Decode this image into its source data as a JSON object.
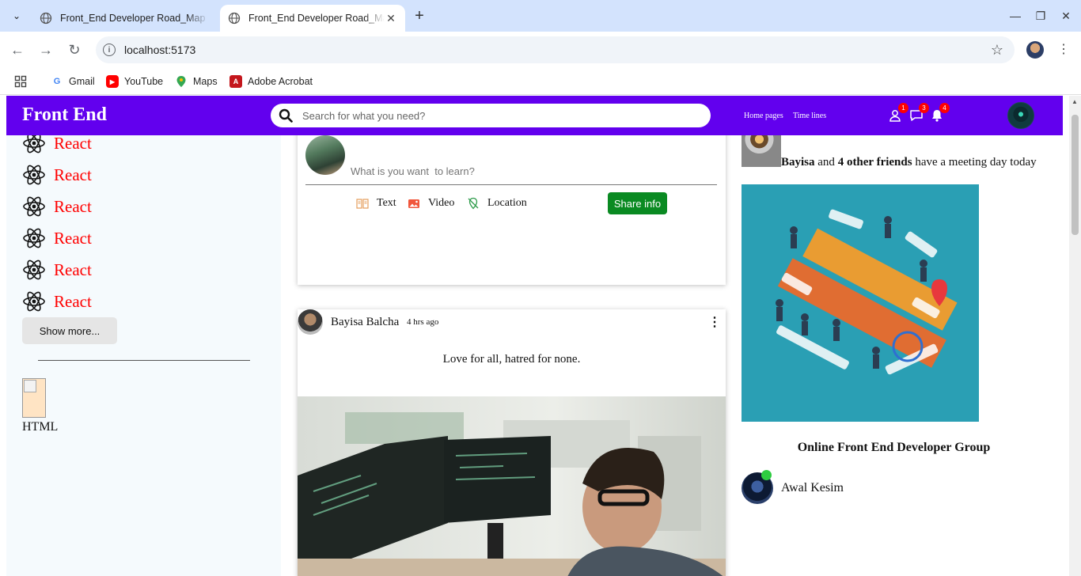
{
  "browser": {
    "tabs": [
      {
        "title": "Front_End Developer Road_Map",
        "active": false
      },
      {
        "title": "Front_End Developer Road_Map",
        "active": true
      }
    ],
    "url": "localhost:5173",
    "bookmarks": [
      {
        "label": "Gmail",
        "icon": "gmail-icon"
      },
      {
        "label": "YouTube",
        "icon": "youtube-icon"
      },
      {
        "label": "Maps",
        "icon": "maps-icon"
      },
      {
        "label": "Adobe Acrobat",
        "icon": "acrobat-icon"
      }
    ]
  },
  "header": {
    "brand": "Front End",
    "search_placeholder": "Search for what you need?",
    "nav": [
      "Home pages",
      "Time lines"
    ],
    "badges": {
      "friends": "1",
      "messages": "3",
      "notifications": "4"
    },
    "accent_color": "#6200ee"
  },
  "sidebar": {
    "items": [
      "React",
      "React",
      "React",
      "React",
      "React",
      "React"
    ],
    "show_more": "Show more...",
    "bottom_label": "HTML",
    "item_color": "#ff0000"
  },
  "composer": {
    "placeholder": "What is you want  to learn?",
    "actions": [
      "Text",
      "Video",
      "Location"
    ],
    "share": "Share info"
  },
  "post": {
    "author": "Bayisa Balcha",
    "time": "4 hrs ago",
    "text": "Love for all, hatred for none."
  },
  "right": {
    "event_name": "Bayisa",
    "event_mid": "and",
    "event_friends": "4 other friends",
    "event_tail": "have a meeting day today",
    "group_title": "Online Front End Developer Group",
    "friend_name": "Awal Kesim"
  }
}
